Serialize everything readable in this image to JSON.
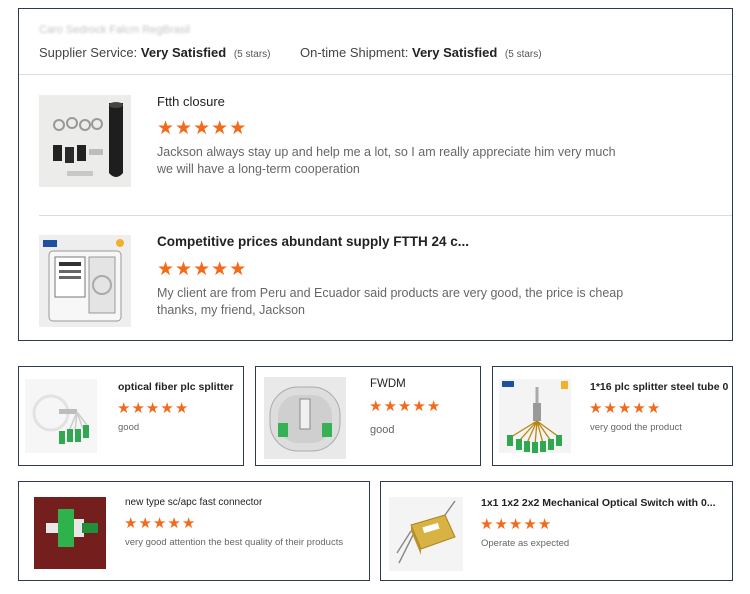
{
  "main_review": {
    "reviewer": "Caro Sedrock Falcm RegBrasil",
    "supplier_service": {
      "label": "Supplier Service:",
      "value": "Very Satisfied",
      "stars_text": "(5 stars)"
    },
    "ontime_shipment": {
      "label": "On-time Shipment:",
      "value": "Very Satisfied",
      "stars_text": "(5 stars)"
    },
    "items": [
      {
        "title": "Ftth closure",
        "rating": 5,
        "comment_line1": "Jackson always stay up and help me a lot,  so I am really appreciate him very much",
        "comment_line2": "we will have a long-term cooperation"
      },
      {
        "title": "Competitive prices abundant supply FTTH 24 c...",
        "rating": 5,
        "comment_line1": "My client are from Peru and Ecuador said  products are very good,  the price is cheap",
        "comment_line2": "thanks,  my friend,  Jackson"
      }
    ]
  },
  "small_reviews": [
    {
      "title": "optical fiber plc splitter",
      "rating": 5,
      "comment": "good"
    },
    {
      "title": "FWDM",
      "rating": 5,
      "comment": "good"
    },
    {
      "title": "1*16 plc splitter steel tube 0",
      "rating": 5,
      "comment": "very good the product"
    },
    {
      "title": "new type sc/apc fast connector",
      "rating": 5,
      "comment": "very good attention the best quality of their products"
    },
    {
      "title": "1x1 1x2 2x2 Mechanical Optical Switch with 0...",
      "rating": 5,
      "comment": "Operate as expected"
    }
  ],
  "star_glyph": "★",
  "star_color": "#f26a1b"
}
